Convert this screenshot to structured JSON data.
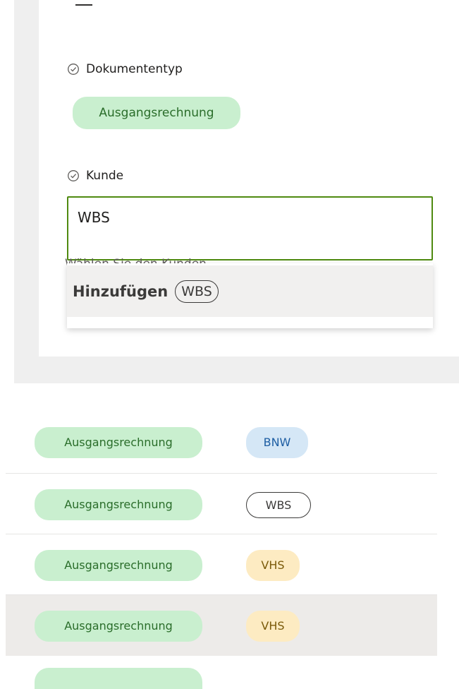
{
  "form": {
    "doctype": {
      "label": "Dokumententyp",
      "value": "Ausgangsrechnung"
    },
    "customer": {
      "label": "Kunde",
      "input_value": "WBS",
      "hint": "Wählen Sie den Kunden"
    },
    "dropdown": {
      "add_label": "Hinzufügen",
      "add_value": "WBS"
    }
  },
  "list": {
    "rows": [
      {
        "doctype": "Ausgangsrechnung",
        "customer": "BNW",
        "style": "blue"
      },
      {
        "doctype": "Ausgangsrechnung",
        "customer": "WBS",
        "style": "outline"
      },
      {
        "doctype": "Ausgangsrechnung",
        "customer": "VHS",
        "style": "yellow"
      },
      {
        "doctype": "Ausgangsrechnung",
        "customer": "VHS",
        "style": "yellow"
      }
    ]
  },
  "colors": {
    "doctype_pill": "#c9efcf",
    "input_border": "#4f8a10",
    "bnw_pill": "#d5e7f6",
    "vhs_pill": "#fdebc2"
  }
}
